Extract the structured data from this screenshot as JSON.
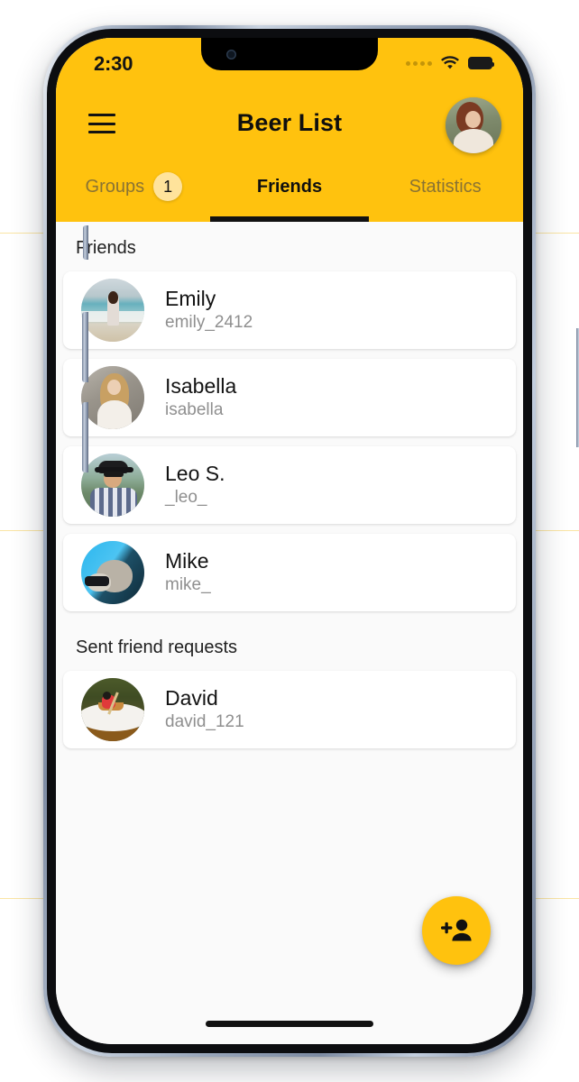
{
  "status_bar": {
    "time": "2:30",
    "icons": [
      "signal-dots-icon",
      "wifi-icon",
      "battery-icon"
    ]
  },
  "app_bar": {
    "menu_icon": "hamburger-menu-icon",
    "title": "Beer List",
    "avatar": "user-avatar"
  },
  "tabs": [
    {
      "label": "Groups",
      "badge": "1",
      "active": false
    },
    {
      "label": "Friends",
      "badge": "",
      "active": true
    },
    {
      "label": "Statistics",
      "badge": "",
      "active": false
    }
  ],
  "sections": [
    {
      "header": "Friends",
      "items": [
        {
          "name": "Emily",
          "handle": "emily_2412"
        },
        {
          "name": "Isabella",
          "handle": "isabella"
        },
        {
          "name": "Leo S.",
          "handle": "_leo_"
        },
        {
          "name": "Mike",
          "handle": "mike_"
        }
      ]
    },
    {
      "header": "Sent friend requests",
      "items": [
        {
          "name": "David",
          "handle": "david_121"
        }
      ]
    }
  ],
  "fab": {
    "icon": "person-add-icon"
  },
  "colors": {
    "accent": "#FFC20E",
    "badge": "#FFE39B",
    "background": "#FAFAFA",
    "card": "#FFFFFF",
    "primary_text": "#131313",
    "secondary_text": "#8F8F8F",
    "inactive_tab_text": "#8A7333"
  }
}
